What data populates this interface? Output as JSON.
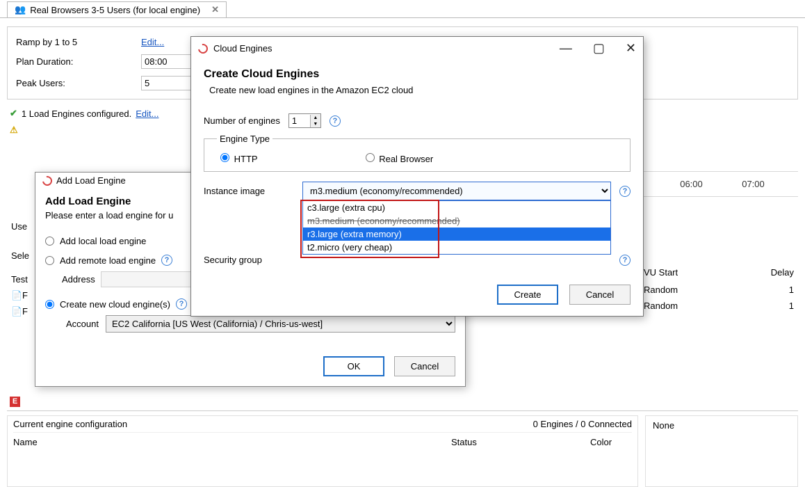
{
  "tab": {
    "title": "Real Browsers 3-5 Users (for local engine)"
  },
  "form": {
    "ramp_label": "Ramp by 1 to 5",
    "ramp_link": "Edit...",
    "duration_label": "Plan Duration:",
    "duration_value": "08:00",
    "peak_label": "Peak Users:",
    "peak_value": "5"
  },
  "status": {
    "ok_text": "1 Load Engines configured.",
    "ok_link": "Edit..."
  },
  "timeline": {
    "tick1": "06:00",
    "tick2": "07:00"
  },
  "use_label": "Use",
  "select_label": "Sele",
  "test_label": "Test",
  "table": {
    "hdr_vu_start": "VU Start",
    "hdr_delay": "Delay",
    "row1_vu": "Random",
    "row1_delay": "1",
    "row2_vu": "Random",
    "row2_delay": "1"
  },
  "err_badge": "E",
  "engine_panel": {
    "title": "Current engine configuration",
    "status_right": "0 Engines / 0 Connected",
    "col_name": "Name",
    "col_status": "Status",
    "col_color": "Color",
    "right_title": "None"
  },
  "dlg_add": {
    "title_bar": "Add Load Engine",
    "heading": "Add Load Engine",
    "subhead": "Please enter a load engine for u",
    "opt_local": "Add local load engine",
    "opt_remote": "Add remote load engine",
    "address_label": "Address",
    "opt_cloud": "Create new cloud engine(s)",
    "account_label": "Account",
    "account_value": "EC2 California [US West (California) / Chris-us-west]",
    "ok": "OK",
    "cancel": "Cancel"
  },
  "dlg_cloud": {
    "title_bar": "Cloud Engines",
    "heading": "Create Cloud Engines",
    "subhead": "Create new load engines in the Amazon EC2 cloud",
    "num_engines_label": "Number of engines",
    "num_engines_value": "1",
    "engine_type_legend": "Engine Type",
    "radio_http": "HTTP",
    "radio_real": "Real Browser",
    "instance_label": "Instance image",
    "instance_selected": "m3.medium (economy/recommended)",
    "security_label": "Security group",
    "dropdown": {
      "opt1": "c3.large (extra cpu)",
      "opt2": "m3.medium (economy/recommended)",
      "opt3": "r3.large (extra memory)",
      "opt4": "t2.micro (very cheap)"
    },
    "create": "Create",
    "cancel": "Cancel"
  }
}
